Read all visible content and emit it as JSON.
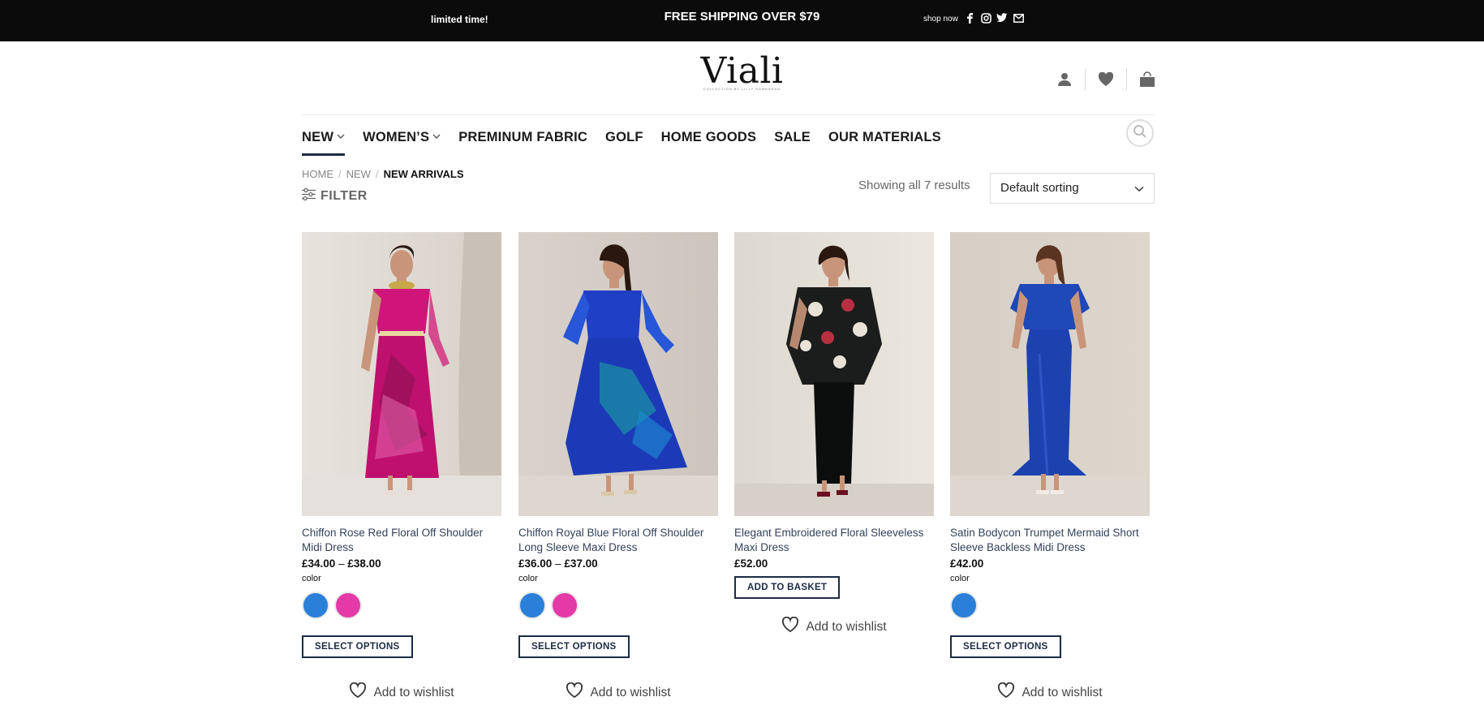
{
  "topbar": {
    "left_promo": "limited time!",
    "center_promo": "FREE SHIPPING OVER $79",
    "shop_now": "shop now",
    "social_icons": [
      "facebook-icon",
      "instagram-icon",
      "twitter-icon",
      "email-icon"
    ]
  },
  "header": {
    "logo": "Viali",
    "logo_tagline": "COLLECTION BY LILLY RAMBARAN",
    "icons": [
      "account-icon",
      "wishlist-icon",
      "cart-icon"
    ]
  },
  "nav": {
    "items": [
      {
        "label": "NEW",
        "has_dropdown": true,
        "active": true
      },
      {
        "label": "WOMEN’S",
        "has_dropdown": true,
        "active": false
      },
      {
        "label": "PREMINUM FABRIC",
        "has_dropdown": false,
        "active": false
      },
      {
        "label": "GOLF",
        "has_dropdown": false,
        "active": false
      },
      {
        "label": "HOME GOODS",
        "has_dropdown": false,
        "active": false
      },
      {
        "label": "SALE",
        "has_dropdown": false,
        "active": false
      },
      {
        "label": "OUR MATERIALS",
        "has_dropdown": false,
        "active": false
      }
    ]
  },
  "breadcrumb": {
    "home": "HOME",
    "new": "NEW",
    "current": "NEW ARRIVALS"
  },
  "filter_label": "FILTER",
  "results_text": "Showing all 7 results",
  "sorting": {
    "selected": "Default sorting"
  },
  "colors": {
    "accent": "#1d2a44",
    "swatch_blue": "#2a7fd8",
    "swatch_pink": "#e43aa8"
  },
  "products": [
    {
      "name": "Chiffon Rose Red Floral Off Shoulder Midi Dress",
      "price_low": "£34.00",
      "price_sep": "–",
      "price_high": "£38.00",
      "color_label": "color",
      "swatches": [
        "blue",
        "pink"
      ],
      "button": "SELECT OPTIONS",
      "wishlist": "Add to wishlist"
    },
    {
      "name": "Chiffon Royal Blue Floral Off Shoulder Long Sleeve Maxi Dress",
      "price_low": "£36.00",
      "price_sep": "–",
      "price_high": "£37.00",
      "color_label": "color",
      "swatches": [
        "blue",
        "pink"
      ],
      "button": "SELECT OPTIONS",
      "wishlist": "Add to wishlist"
    },
    {
      "name": "Elegant Embroidered Floral Sleeveless Maxi Dress",
      "price": "£52.00",
      "button": "ADD TO BASKET",
      "wishlist": "Add to wishlist"
    },
    {
      "name": "Satin Bodycon Trumpet Mermaid Short Sleeve Backless Midi Dress",
      "price": "£42.00",
      "color_label": "color",
      "swatches": [
        "blue"
      ],
      "button": "SELECT OPTIONS",
      "wishlist": "Add to wishlist"
    }
  ]
}
